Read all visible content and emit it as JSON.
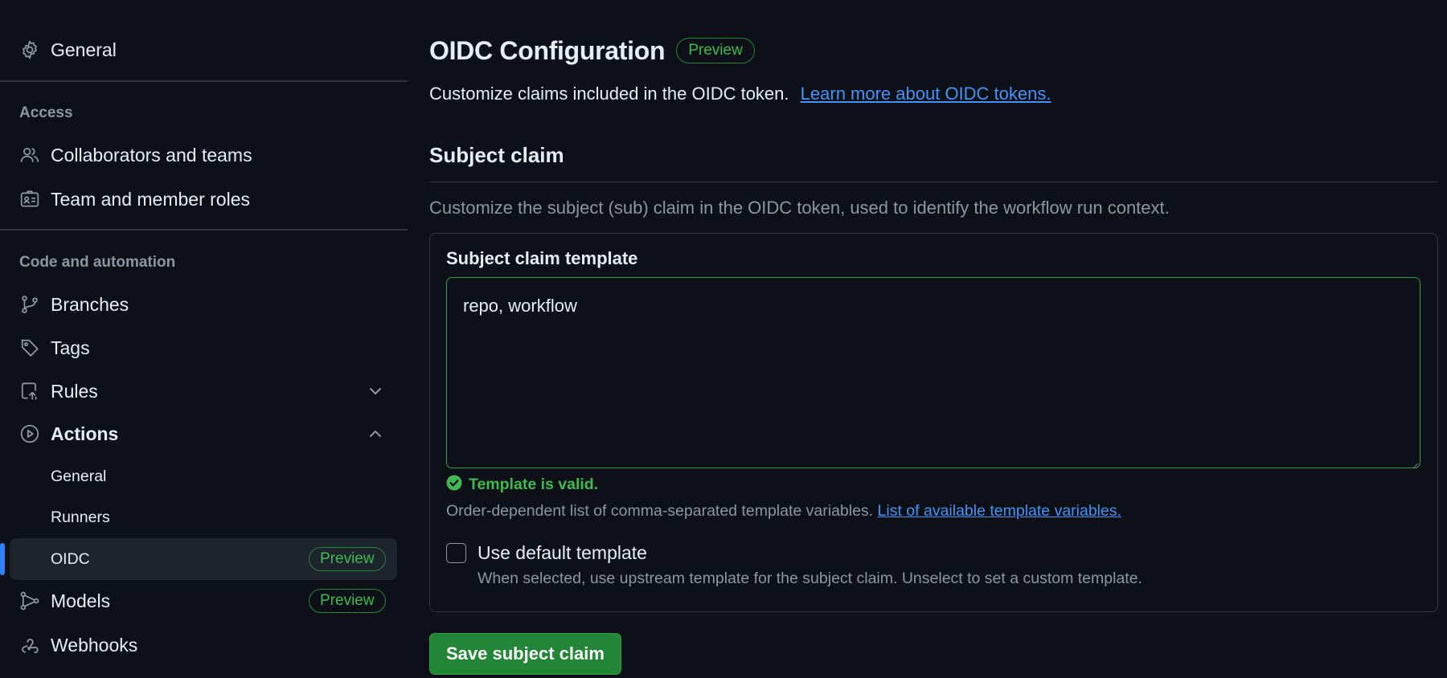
{
  "sidebar": {
    "general": "General",
    "access_heading": "Access",
    "access_items": [
      {
        "label": "Collaborators and teams",
        "icon": "people-icon"
      },
      {
        "label": "Team and member roles",
        "icon": "id-badge-icon"
      }
    ],
    "code_heading": "Code and automation",
    "branches": "Branches",
    "tags": "Tags",
    "rules": "Rules",
    "actions": "Actions",
    "actions_sub": {
      "general": "General",
      "runners": "Runners",
      "oidc": "OIDC",
      "oidc_badge": "Preview"
    },
    "models": "Models",
    "models_badge": "Preview",
    "webhooks": "Webhooks"
  },
  "main": {
    "title": "OIDC Configuration",
    "title_badge": "Preview",
    "intro_text": "Customize claims included in the OIDC token.",
    "intro_link": "Learn more about OIDC tokens.",
    "section_title": "Subject claim",
    "section_desc": "Customize the subject (sub) claim in the OIDC token, used to identify the workflow run context.",
    "template_label": "Subject claim template",
    "template_value": "repo, workflow",
    "valid_text": "Template is valid.",
    "hint_text": "Order-dependent list of comma-separated template variables.",
    "hint_link": "List of available template variables.",
    "default_label": "Use default template",
    "default_checked": false,
    "default_help": "When selected, use upstream template for the subject claim. Unselect to set a custom template.",
    "save_label": "Save subject claim"
  },
  "colors": {
    "background": "#0d1117",
    "accent_green": "#238636",
    "valid_green": "#3fb950",
    "link_blue": "#4493f8",
    "active_indicator": "#2f81f7"
  }
}
